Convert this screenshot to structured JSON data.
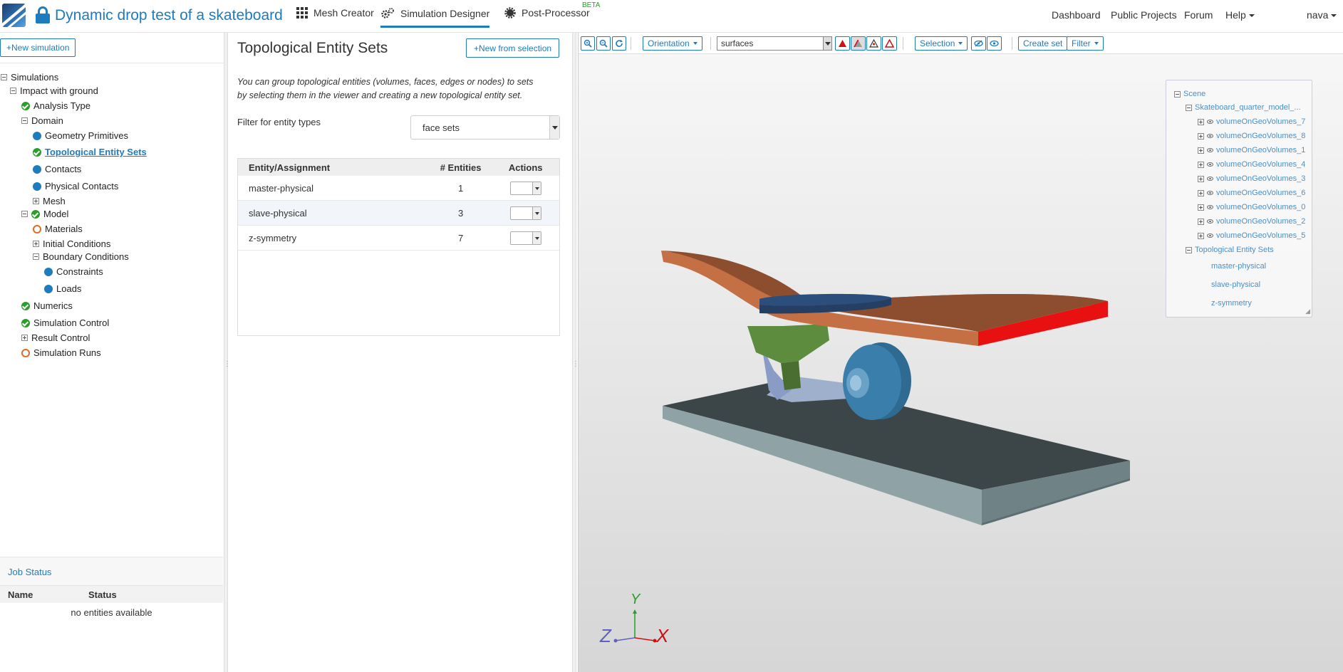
{
  "header": {
    "project_title": "Dynamic drop test of a skateboard",
    "tabs": [
      {
        "label": "Mesh Creator"
      },
      {
        "label": "Simulation Designer"
      },
      {
        "label": "Post-Processor"
      }
    ],
    "beta_badge": "BETA",
    "nav": {
      "dashboard": "Dashboard",
      "public_projects": "Public Projects",
      "forum": "Forum",
      "help": "Help",
      "user": "nava"
    }
  },
  "sidebar": {
    "new_simulation": "+New simulation",
    "tree": {
      "simulations": "Simulations",
      "impact": "Impact with ground",
      "analysis_type": "Analysis Type",
      "domain": "Domain",
      "geometry_primitives": "Geometry Primitives",
      "topological_entity_sets": "Topological Entity Sets",
      "contacts": "Contacts",
      "physical_contacts": "Physical Contacts",
      "mesh": "Mesh",
      "model": "Model",
      "materials": "Materials",
      "initial_conditions": "Initial Conditions",
      "boundary_conditions": "Boundary Conditions",
      "constraints": "Constraints",
      "loads": "Loads",
      "numerics": "Numerics",
      "simulation_control": "Simulation Control",
      "result_control": "Result Control",
      "simulation_runs": "Simulation Runs"
    },
    "job_status": {
      "title": "Job Status",
      "col_name": "Name",
      "col_status": "Status",
      "empty": "no entities available"
    }
  },
  "main": {
    "title": "Topological Entity Sets",
    "new_from_selection": "+New from selection",
    "description": "You can group topological entities (volumes, faces, edges or nodes) to sets by selecting them in the viewer and creating a new topological entity set.",
    "filter_label": "Filter for entity types",
    "filter_value": "face sets",
    "table": {
      "headers": [
        "Entity/Assignment",
        "# Entities",
        "Actions"
      ],
      "rows": [
        {
          "name": "master-physical",
          "count": "1"
        },
        {
          "name": "slave-physical",
          "count": "3"
        },
        {
          "name": "z-symmetry",
          "count": "7"
        }
      ]
    }
  },
  "viewer": {
    "toolbar": {
      "orientation": "Orientation",
      "render_mode": "surfaces",
      "selection": "Selection",
      "create_set": "Create set",
      "filter": "Filter"
    },
    "scene_tree": {
      "scene": "Scene",
      "model": "Skateboard_quarter_model_...",
      "volumes": [
        "volumeOnGeoVolumes_7",
        "volumeOnGeoVolumes_8",
        "volumeOnGeoVolumes_1",
        "volumeOnGeoVolumes_4",
        "volumeOnGeoVolumes_3",
        "volumeOnGeoVolumes_6",
        "volumeOnGeoVolumes_0",
        "volumeOnGeoVolumes_2",
        "volumeOnGeoVolumes_5"
      ],
      "topo_sets_label": "Topological Entity Sets",
      "topo_sets": [
        "master-physical",
        "slave-physical",
        "z-symmetry"
      ]
    },
    "axes": {
      "x": "X",
      "y": "Y",
      "z": "Z"
    },
    "colors": {
      "deck": "#c56f45",
      "deck_top": "#8d4e2f",
      "highlight": "#e81010",
      "ground_top": "#3c4548",
      "ground_side": "#7f9397",
      "wheel": "#3a7fab",
      "truck": "#5e8c3e",
      "pad": "#2b4e7c"
    }
  }
}
